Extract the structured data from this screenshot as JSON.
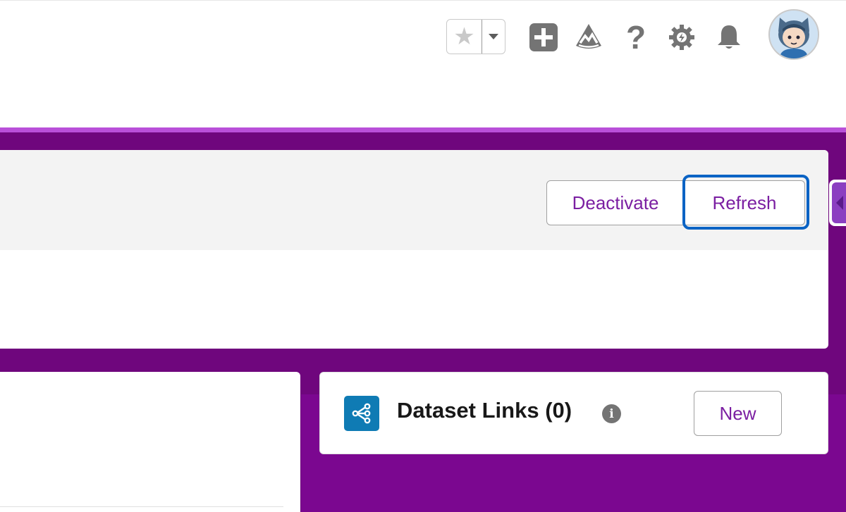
{
  "header": {
    "favorite_icon": "star-icon",
    "favorites_menu_icon": "caret-down-icon",
    "icons": [
      "add-icon",
      "trailhead-icon",
      "help-icon",
      "setup-gear-icon",
      "notifications-bell-icon"
    ],
    "help_glyph": "?",
    "avatar_icon": "user-avatar-icon"
  },
  "highlights": {
    "deactivate_label": "Deactivate",
    "refresh_label": "Refresh"
  },
  "dataset_links": {
    "icon": "dataset-link-icon",
    "title": "Dataset Links (0)",
    "info_glyph": "i",
    "new_label": "New"
  },
  "colors": {
    "brand_purple": "#6f067d",
    "brand_stripe": "#b94fd9",
    "button_text": "#7b1fa2",
    "focus_ring": "#0b63c4",
    "dataset_icon_bg": "#0f7bb4"
  }
}
